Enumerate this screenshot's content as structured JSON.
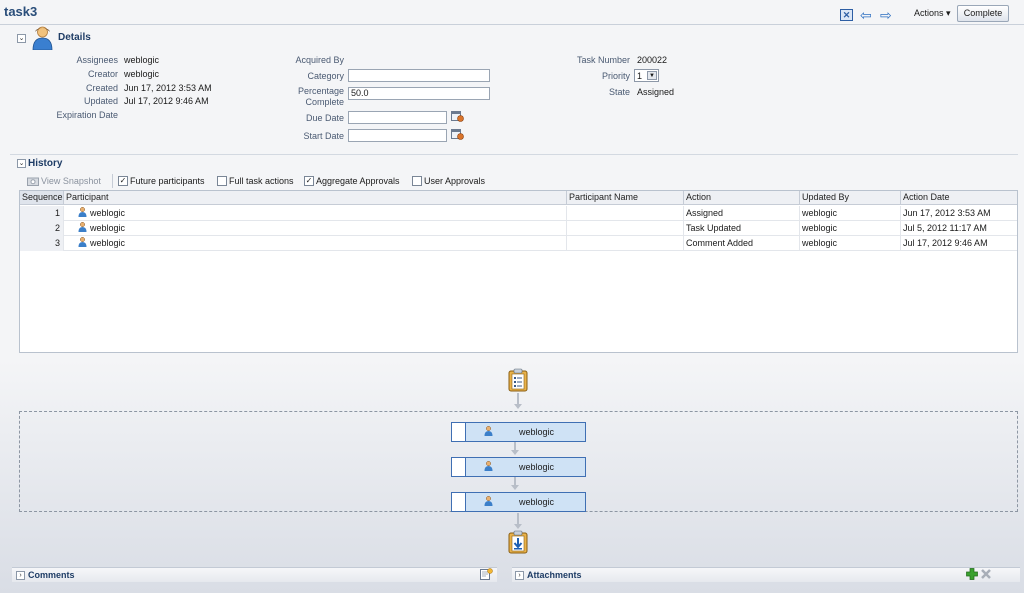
{
  "header": {
    "title": "task3",
    "actions_label": "Actions ▾",
    "complete_label": "Complete"
  },
  "details": {
    "section_title": "Details",
    "left": [
      {
        "label": "Assignees",
        "value": "weblogic"
      },
      {
        "label": "Creator",
        "value": "weblogic"
      },
      {
        "label": "Created",
        "value": "Jun 17, 2012 3:53 AM"
      },
      {
        "label": "Updated",
        "value": "Jul 17, 2012 9:46 AM"
      },
      {
        "label": "Expiration Date",
        "value": ""
      }
    ],
    "acquired_by_label": "Acquired By",
    "category_label": "Category",
    "category_value": "",
    "percentage_label_1": "Percentage",
    "percentage_label_2": "Complete",
    "percentage_value": "50.0",
    "due_date_label": "Due Date",
    "due_date_value": "",
    "start_date_label": "Start Date",
    "start_date_value": "",
    "task_number_label": "Task Number",
    "task_number_value": "200022",
    "priority_label": "Priority",
    "priority_value": "1",
    "state_label": "State",
    "state_value": "Assigned"
  },
  "history": {
    "section_title": "History",
    "view_snapshot_label": "View Snapshot",
    "checkboxes": [
      {
        "label": "Future participants",
        "checked": true
      },
      {
        "label": "Full task actions",
        "checked": false
      },
      {
        "label": "Aggregate Approvals",
        "checked": true
      },
      {
        "label": "User Approvals",
        "checked": false
      }
    ],
    "columns": [
      "Sequence",
      "Participant",
      "Participant Name",
      "Action",
      "Updated By",
      "Action Date"
    ],
    "rows": [
      {
        "seq": "1",
        "participant": "weblogic",
        "participant_name": "",
        "action": "Assigned",
        "updated_by": "weblogic",
        "date": "Jun 17, 2012 3:53 AM"
      },
      {
        "seq": "2",
        "participant": "weblogic",
        "participant_name": "",
        "action": "Task Updated",
        "updated_by": "weblogic",
        "date": "Jul 5, 2012 11:17 AM"
      },
      {
        "seq": "3",
        "participant": "weblogic",
        "participant_name": "",
        "action": "Comment Added",
        "updated_by": "weblogic",
        "date": "Jul 17, 2012 9:46 AM"
      }
    ]
  },
  "flow": {
    "participants": [
      "weblogic",
      "weblogic",
      "weblogic"
    ]
  },
  "comments": {
    "title": "Comments"
  },
  "attachments": {
    "title": "Attachments"
  },
  "colors": {
    "accent": "#2a4e7a",
    "flow_box": "#cfe2f5",
    "add_icon": "#3aa12f"
  }
}
